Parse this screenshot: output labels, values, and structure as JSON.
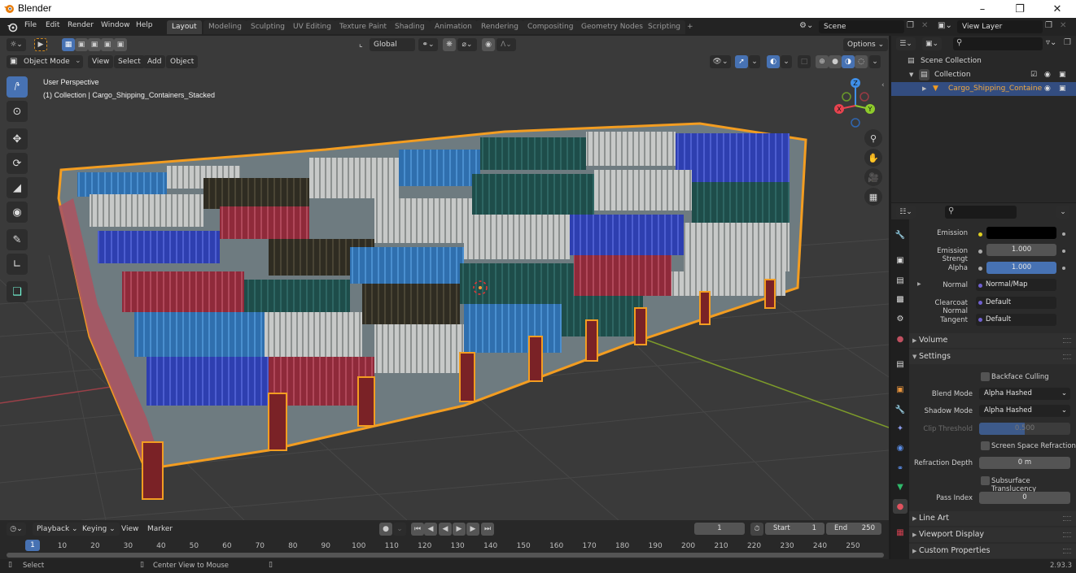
{
  "window": {
    "title": "Blender",
    "controls": {
      "minimize": "–",
      "maximize": "❐",
      "close": "✕"
    }
  },
  "menubar": {
    "items": [
      "File",
      "Edit",
      "Render",
      "Window",
      "Help"
    ]
  },
  "workspaces": {
    "tabs": [
      "Layout",
      "Modeling",
      "Sculpting",
      "UV Editing",
      "Texture Paint",
      "Shading",
      "Animation",
      "Rendering",
      "Compositing",
      "Geometry Nodes",
      "Scripting"
    ],
    "active": "Layout",
    "add": "+"
  },
  "scene": {
    "name": "Scene",
    "view_layer": "View Layer"
  },
  "viewport": {
    "mode": "Object Mode",
    "menus": [
      "View",
      "Select",
      "Add",
      "Object"
    ],
    "transform_orientation": "Global",
    "options_label": "Options",
    "info_line1": "User Perspective",
    "info_line2": "(1) Collection | Cargo_Shipping_Containers_Stacked",
    "gizmo_axes": {
      "x": "X",
      "y": "Y",
      "z": "Z"
    },
    "colors": {
      "x_axis": "#e8434f",
      "y_axis": "#8ecb2b",
      "z_axis": "#3f8fe8",
      "selection_outline": "#f39d21"
    }
  },
  "outliner": {
    "items": [
      {
        "label": "Scene Collection",
        "level": 0
      },
      {
        "label": "Collection",
        "level": 1,
        "checked": true
      },
      {
        "label": "Cargo_Shipping_Containe",
        "level": 2,
        "selected": true
      }
    ]
  },
  "properties": {
    "rows": [
      {
        "label": "Emission",
        "value": "",
        "kind": "color",
        "socket": "yellow"
      },
      {
        "label": "Emission Strengt",
        "value": "1.000",
        "kind": "number",
        "socket": "gray"
      },
      {
        "label": "Alpha",
        "value": "1.000",
        "kind": "slider",
        "socket": "gray",
        "fill": 1.0
      },
      {
        "label": "Normal",
        "value": "Normal/Map",
        "kind": "link",
        "socket": "purple"
      },
      {
        "label": "Clearcoat Normal",
        "value": "Default",
        "kind": "link",
        "socket": "purple"
      },
      {
        "label": "Tangent",
        "value": "Default",
        "kind": "link",
        "socket": "purple"
      }
    ],
    "panels": {
      "volume": "Volume",
      "settings": "Settings",
      "line_art": "Line Art",
      "viewport_display": "Viewport Display",
      "custom_properties": "Custom Properties"
    },
    "settings": {
      "backface_culling": {
        "label": "Backface Culling",
        "checked": false
      },
      "blend_mode": {
        "label": "Blend Mode",
        "value": "Alpha Hashed"
      },
      "shadow_mode": {
        "label": "Shadow Mode",
        "value": "Alpha Hashed"
      },
      "clip_threshold": {
        "label": "Clip Threshold",
        "value": "0.500",
        "fill": 0.5
      },
      "screen_space_refraction": {
        "label": "Screen Space Refraction",
        "checked": false
      },
      "refraction_depth": {
        "label": "Refraction Depth",
        "value": "0 m"
      },
      "subsurface_translucency": {
        "label": "Subsurface Translucency",
        "checked": false
      },
      "pass_index": {
        "label": "Pass Index",
        "value": "0"
      }
    }
  },
  "timeline": {
    "menus": [
      "Playback",
      "Keying",
      "View",
      "Marker"
    ],
    "current_frame": "1",
    "start_label": "Start",
    "start": "1",
    "end_label": "End",
    "end": "250",
    "ticks": [
      "10",
      "20",
      "30",
      "40",
      "50",
      "60",
      "70",
      "80",
      "90",
      "100",
      "110",
      "120",
      "130",
      "140",
      "150",
      "160",
      "170",
      "180",
      "190",
      "200",
      "210",
      "220",
      "230",
      "240",
      "250"
    ],
    "playhead": "1"
  },
  "statusbar": {
    "select": "Select",
    "center_view": "Center View to Mouse",
    "version": "2.93.3"
  }
}
